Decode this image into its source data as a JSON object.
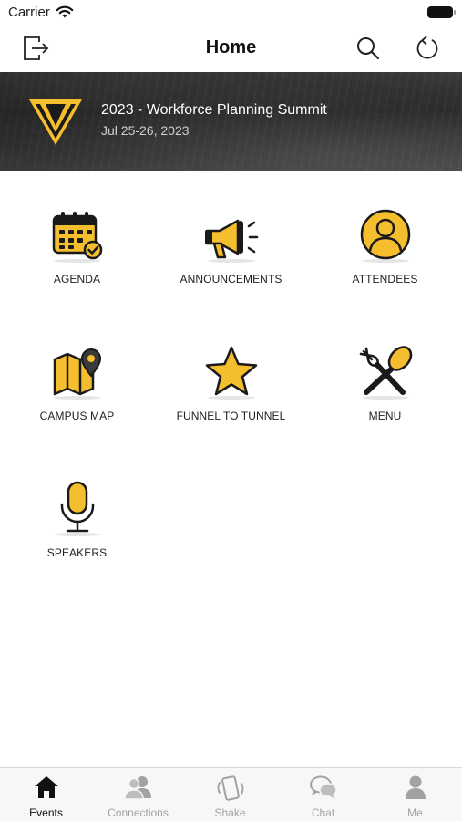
{
  "status_bar": {
    "carrier": "Carrier"
  },
  "nav": {
    "title": "Home"
  },
  "banner": {
    "title": "2023 - Workforce Planning Summit",
    "date": "Jul 25-26, 2023"
  },
  "colors": {
    "accent_yellow": "#F5BE2E",
    "icon_outline": "#1a1a1a",
    "tab_inactive": "#a2a2a2"
  },
  "tiles": [
    {
      "label": "AGENDA",
      "icon": "calendar-icon"
    },
    {
      "label": "ANNOUNCEMENTS",
      "icon": "megaphone-icon"
    },
    {
      "label": "ATTENDEES",
      "icon": "person-icon"
    },
    {
      "label": "CAMPUS MAP",
      "icon": "map-icon"
    },
    {
      "label": "FUNNEL TO TUNNEL",
      "icon": "star-icon"
    },
    {
      "label": "MENU",
      "icon": "fork-spoon-icon"
    },
    {
      "label": "SPEAKERS",
      "icon": "microphone-icon"
    }
  ],
  "tabs": [
    {
      "label": "Events",
      "icon": "home-icon",
      "active": true
    },
    {
      "label": "Connections",
      "icon": "people-icon",
      "active": false
    },
    {
      "label": "Shake",
      "icon": "phone-shake-icon",
      "active": false
    },
    {
      "label": "Chat",
      "icon": "chat-bubbles-icon",
      "active": false
    },
    {
      "label": "Me",
      "icon": "user-icon",
      "active": false
    }
  ]
}
